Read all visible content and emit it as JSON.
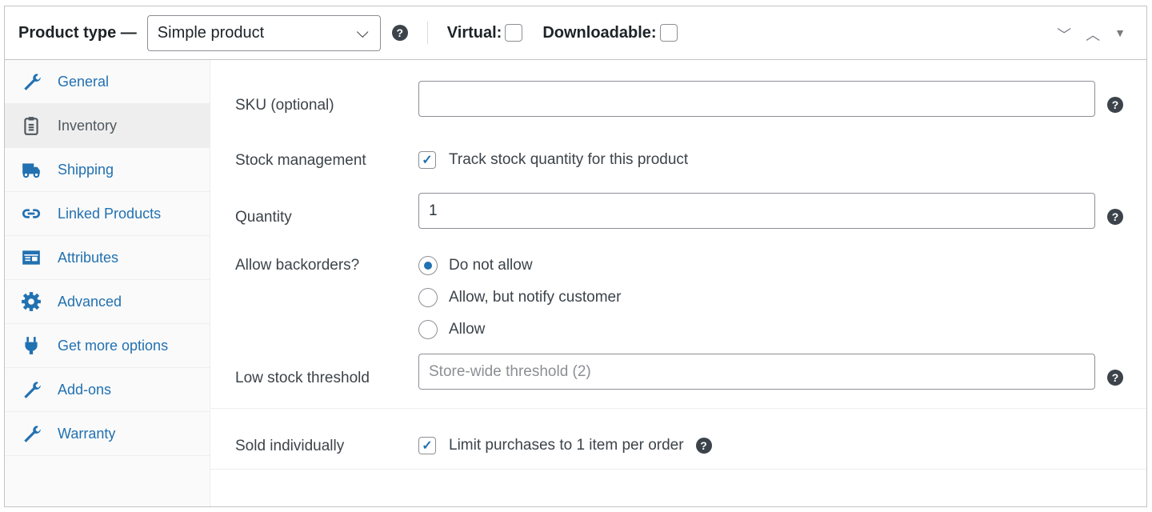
{
  "header": {
    "product_type_label": "Product type —",
    "product_type_value": "Simple product",
    "virtual_label": "Virtual:",
    "downloadable_label": "Downloadable:",
    "virtual_checked": false,
    "downloadable_checked": false
  },
  "sidebar": {
    "items": [
      {
        "label": "General",
        "icon": "wrench-icon"
      },
      {
        "label": "Inventory",
        "icon": "clipboard-icon",
        "active": true
      },
      {
        "label": "Shipping",
        "icon": "truck-icon"
      },
      {
        "label": "Linked Products",
        "icon": "link-icon"
      },
      {
        "label": "Attributes",
        "icon": "list-view-icon"
      },
      {
        "label": "Advanced",
        "icon": "gear-icon"
      },
      {
        "label": "Get more options",
        "icon": "plug-icon"
      },
      {
        "label": "Add-ons",
        "icon": "wrench-icon"
      },
      {
        "label": "Warranty",
        "icon": "wrench-icon"
      }
    ]
  },
  "form": {
    "sku_label": "SKU (optional)",
    "sku_value": "",
    "stock_label": "Stock management",
    "stock_text": "Track stock quantity for this product",
    "stock_checked": true,
    "qty_label": "Quantity",
    "qty_value": "1",
    "backorders_label": "Allow backorders?",
    "backorder_options": [
      "Do not allow",
      "Allow, but notify customer",
      "Allow"
    ],
    "backorder_selected": "Do not allow",
    "low_label": "Low stock threshold",
    "low_placeholder": "Store-wide threshold (2)",
    "sold_label": "Sold individually",
    "sold_text": "Limit purchases to 1 item per order",
    "sold_checked": true
  },
  "colors": {
    "accent": "#2271b1"
  }
}
